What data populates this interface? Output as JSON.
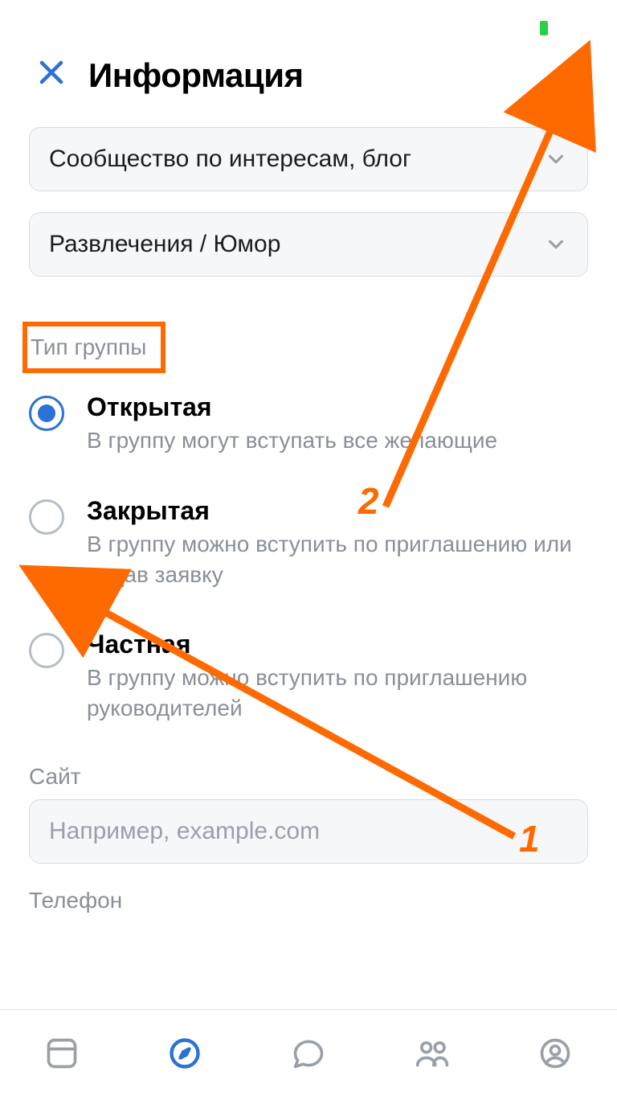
{
  "colors": {
    "accent": "#2a72d3",
    "annotation": "#ff6a00"
  },
  "header": {
    "title": "Информация"
  },
  "selects": {
    "community_type": "Сообщество по интересам, блог",
    "category": "Развлечения / Юмор"
  },
  "group_type": {
    "section_label": "Тип группы",
    "options": [
      {
        "title": "Открытая",
        "desc": "В группу могут вступать все желающие",
        "selected": true
      },
      {
        "title": "Закрытая",
        "desc": "В группу можно вступить по приглашению или подав заявку",
        "selected": false
      },
      {
        "title": "Частная",
        "desc": "В группу можно вступить по приглашению руководителей",
        "selected": false
      }
    ]
  },
  "site": {
    "label": "Сайт",
    "placeholder": "Например, example.com",
    "value": ""
  },
  "phone": {
    "label": "Телефон"
  },
  "annotations": {
    "num1": "1",
    "num2": "2"
  }
}
